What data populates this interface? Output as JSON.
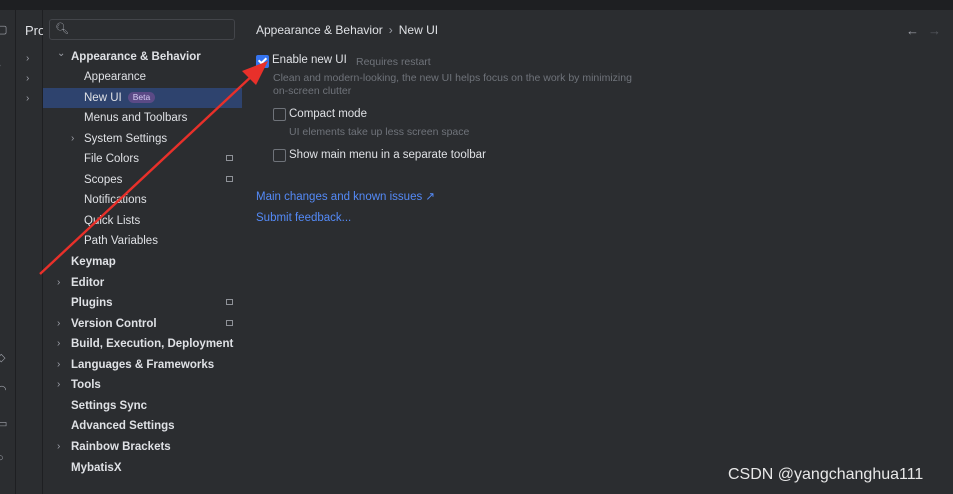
{
  "project_label": "Pro",
  "search": {
    "placeholder": ""
  },
  "tree": [
    {
      "label": "Appearance & Behavior",
      "bold": true,
      "chevron": "down",
      "level": 0
    },
    {
      "label": "Appearance",
      "level": 1
    },
    {
      "label": "New UI",
      "level": 1,
      "selected": true,
      "badge": "Beta"
    },
    {
      "label": "Menus and Toolbars",
      "level": 1
    },
    {
      "label": "System Settings",
      "level": 1,
      "chevron": "right"
    },
    {
      "label": "File Colors",
      "level": 1,
      "project": true
    },
    {
      "label": "Scopes",
      "level": 1,
      "project": true
    },
    {
      "label": "Notifications",
      "level": 1
    },
    {
      "label": "Quick Lists",
      "level": 1
    },
    {
      "label": "Path Variables",
      "level": 1
    },
    {
      "label": "Keymap",
      "bold": true,
      "level": 0
    },
    {
      "label": "Editor",
      "bold": true,
      "chevron": "right",
      "level": 0
    },
    {
      "label": "Plugins",
      "bold": true,
      "level": 0,
      "project": true
    },
    {
      "label": "Version Control",
      "bold": true,
      "chevron": "right",
      "level": 0,
      "project": true
    },
    {
      "label": "Build, Execution, Deployment",
      "bold": true,
      "chevron": "right",
      "level": 0
    },
    {
      "label": "Languages & Frameworks",
      "bold": true,
      "chevron": "right",
      "level": 0
    },
    {
      "label": "Tools",
      "bold": true,
      "chevron": "right",
      "level": 0
    },
    {
      "label": "Settings Sync",
      "bold": true,
      "level": 0
    },
    {
      "label": "Advanced Settings",
      "bold": true,
      "level": 0
    },
    {
      "label": "Rainbow Brackets",
      "bold": true,
      "chevron": "right",
      "level": 0
    },
    {
      "label": "MybatisX",
      "bold": true,
      "level": 0
    }
  ],
  "breadcrumb": {
    "parent": "Appearance & Behavior",
    "separator": "›",
    "current": "New UI"
  },
  "nav": {
    "back": "←",
    "forward": "→"
  },
  "options": {
    "enable": {
      "label": "Enable new UI",
      "note": "Requires restart",
      "checked": true,
      "desc_line1": "Clean and modern-looking, the new UI helps focus on the work by minimizing",
      "desc_line2": "on-screen clutter"
    },
    "compact": {
      "label": "Compact mode",
      "checked": false,
      "desc": "UI elements take up less screen space"
    },
    "mainmenu": {
      "label": "Show main menu in a separate toolbar",
      "checked": false
    }
  },
  "links": {
    "changes": "Main changes and known issues ↗",
    "feedback": "Submit feedback..."
  },
  "watermark": "CSDN @yangchanghua111",
  "colors": {
    "accent": "#3574f0",
    "link": "#548af7",
    "selection": "#2e436e",
    "annotation_arrow": "#e8302a"
  }
}
